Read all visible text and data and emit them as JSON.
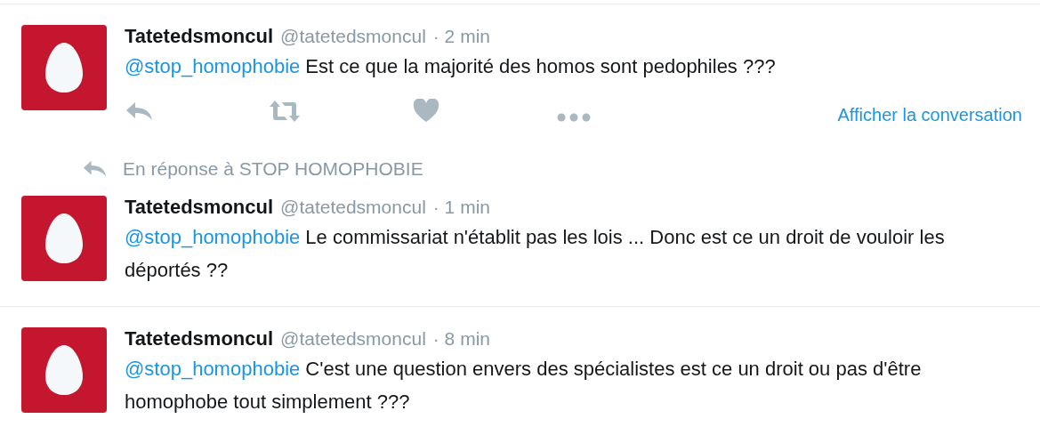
{
  "tweets": [
    {
      "author": {
        "name": "Tatetedsmoncul",
        "handle": "@tatetedsmoncul"
      },
      "time": "· 2 min",
      "mention": "@stop_homophobie",
      "text": " Est ce que la majorité des homos sont pedophiles ???",
      "actions": [
        {
          "kind": "reply"
        },
        {
          "kind": "retweet"
        },
        {
          "kind": "like"
        },
        {
          "kind": "more"
        }
      ],
      "link": "Afficher la conversation"
    },
    {
      "in_reply_to": "En réponse à STOP HOMOPHOBIE",
      "author": {
        "name": "Tatetedsmoncul",
        "handle": "@tatetedsmoncul"
      },
      "time": "· 1 min",
      "mention": "@stop_homophobie",
      "text": " Le commissariat n'établit pas les lois ... Donc est ce un droit de vouloir les déportés ??"
    },
    {
      "author": {
        "name": "Tatetedsmoncul",
        "handle": "@tatetedsmoncul"
      },
      "time": "· 8 min",
      "mention": "@stop_homophobie",
      "text": " C'est une question envers des spécialistes est ce un droit ou pas d'être homophobe tout simplement ???"
    }
  ]
}
